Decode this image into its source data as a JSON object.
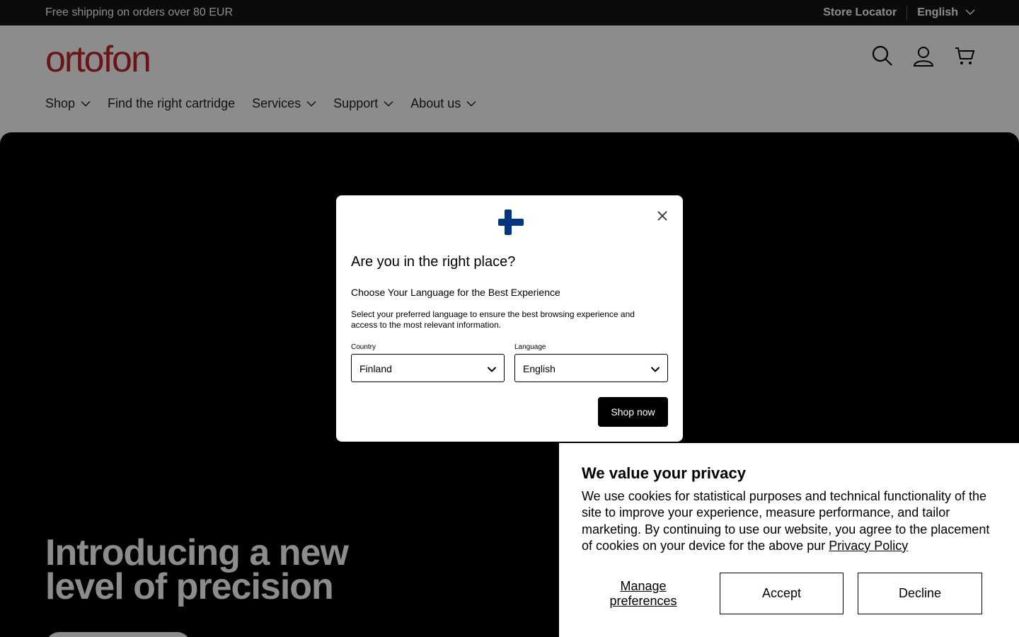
{
  "announcement": {
    "message": "Free shipping on orders over 80 EUR",
    "store_locator": "Store Locator",
    "language": "English"
  },
  "header": {
    "logo": "ortofon",
    "nav": [
      {
        "label": "Shop",
        "dropdown": true
      },
      {
        "label": "Find the right cartridge",
        "dropdown": false
      },
      {
        "label": "Services",
        "dropdown": true
      },
      {
        "label": "Support",
        "dropdown": true
      },
      {
        "label": "About us",
        "dropdown": true
      }
    ],
    "icons": [
      "search-icon",
      "account-icon",
      "cart-icon"
    ]
  },
  "hero": {
    "title_line1": "Introducing a new",
    "title_line2": "level of precision"
  },
  "modal": {
    "title": "Are you in the right place?",
    "subtitle": "Choose Your Language for the Best Experience",
    "description": "Select your preferred language to ensure the best browsing experience and access to the most relevant information.",
    "country_label": "Country",
    "country_value": "Finland",
    "language_label": "Language",
    "language_value": "English",
    "shop_button": "Shop now",
    "flag_color": "#003580"
  },
  "cookie": {
    "title": "We value your privacy",
    "body": "We use cookies for statistical purposes and technical functionality of the site to improve your experience, measure performance, and tailor marketing. By continuing to use our website, you agree to the placement of cookies on your device for the above pur",
    "link": "Privacy Policy",
    "manage": "Manage preferences",
    "accept": "Accept",
    "decline": "Decline"
  },
  "colors": {
    "brand": "#c0272d",
    "announcement_bg": "#141414"
  }
}
